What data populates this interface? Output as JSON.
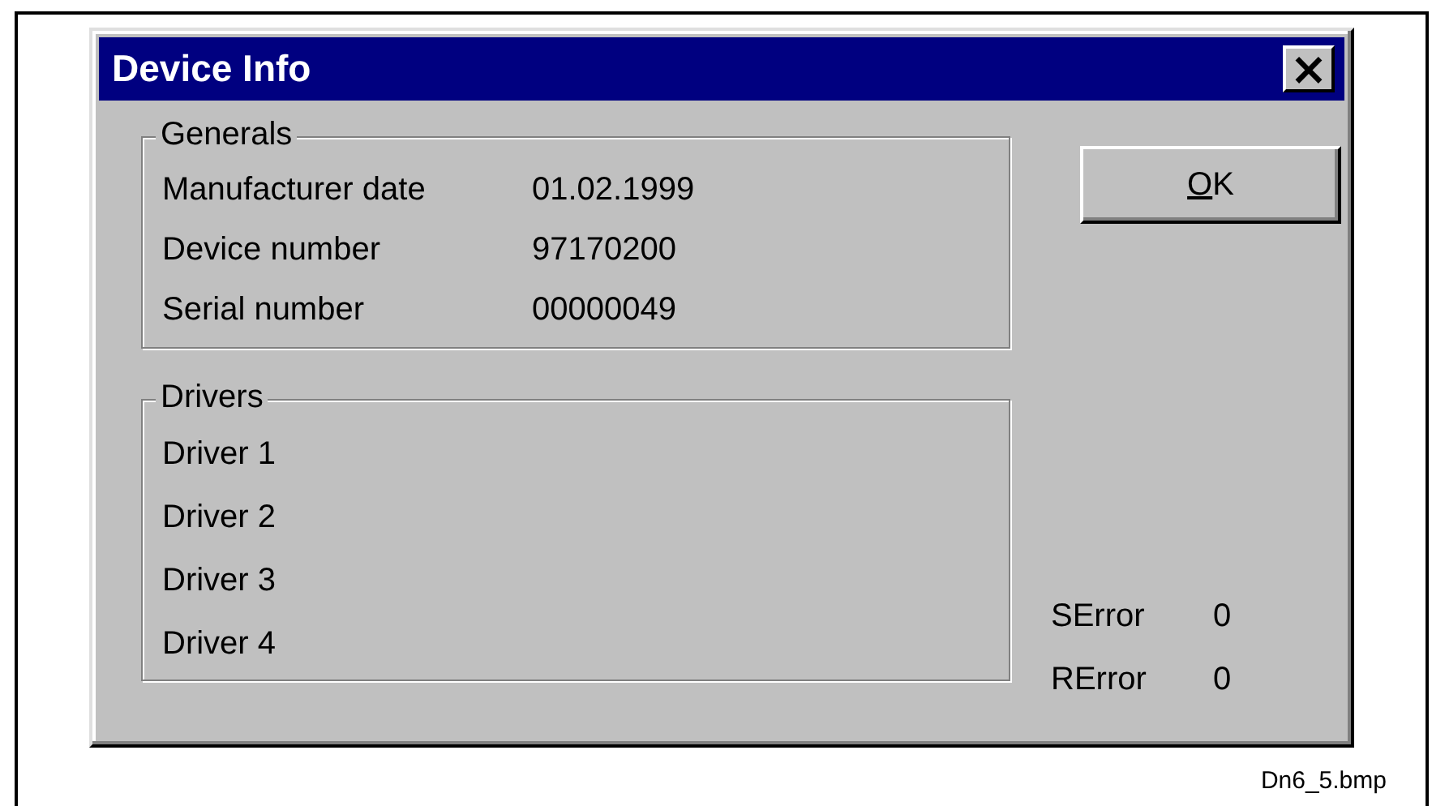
{
  "window": {
    "title": "Device Info",
    "close_glyph": "×"
  },
  "generals": {
    "legend": "Generals",
    "rows": [
      {
        "label": "Manufacturer date",
        "value": "01.02.1999"
      },
      {
        "label": "Device number",
        "value": "97170200"
      },
      {
        "label": "Serial number",
        "value": "00000049"
      }
    ]
  },
  "ok_button": {
    "accel": "O",
    "rest": "K"
  },
  "drivers": {
    "legend": "Drivers",
    "items": [
      "Driver 1",
      "Driver 2",
      "Driver 3",
      "Driver 4"
    ]
  },
  "errors": [
    {
      "label": "SError",
      "value": "0"
    },
    {
      "label": "RError",
      "value": "0"
    }
  ],
  "caption": "Dn6_5.bmp"
}
